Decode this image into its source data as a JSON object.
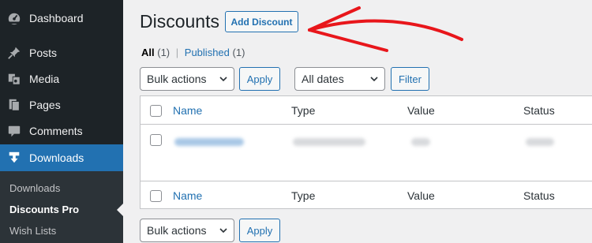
{
  "sidebar": {
    "items": [
      {
        "label": "Dashboard",
        "icon": "dashboard-icon"
      },
      {
        "label": "Posts",
        "icon": "pin-icon"
      },
      {
        "label": "Media",
        "icon": "media-icon"
      },
      {
        "label": "Pages",
        "icon": "pages-icon"
      },
      {
        "label": "Comments",
        "icon": "comment-icon"
      },
      {
        "label": "Downloads",
        "icon": "download-icon",
        "active": true
      }
    ],
    "submenu": [
      {
        "label": "Downloads"
      },
      {
        "label": "Discounts Pro",
        "current": true
      },
      {
        "label": "Wish Lists"
      }
    ]
  },
  "header": {
    "title": "Discounts",
    "add_button": "Add Discount"
  },
  "filters": {
    "all_label": "All",
    "all_count": "(1)",
    "separator": "|",
    "published_label": "Published",
    "published_count": "(1)"
  },
  "tablenav_top": {
    "bulk_actions": "Bulk actions",
    "apply": "Apply",
    "dates": "All dates",
    "filter": "Filter"
  },
  "table": {
    "columns": [
      "Name",
      "Type",
      "Value",
      "Status"
    ]
  },
  "tablenav_bottom": {
    "bulk_actions": "Bulk actions",
    "apply": "Apply"
  },
  "colors": {
    "sidebar_bg": "#1d2327",
    "accent": "#2271b1",
    "annotation_arrow": "#e8161b"
  }
}
